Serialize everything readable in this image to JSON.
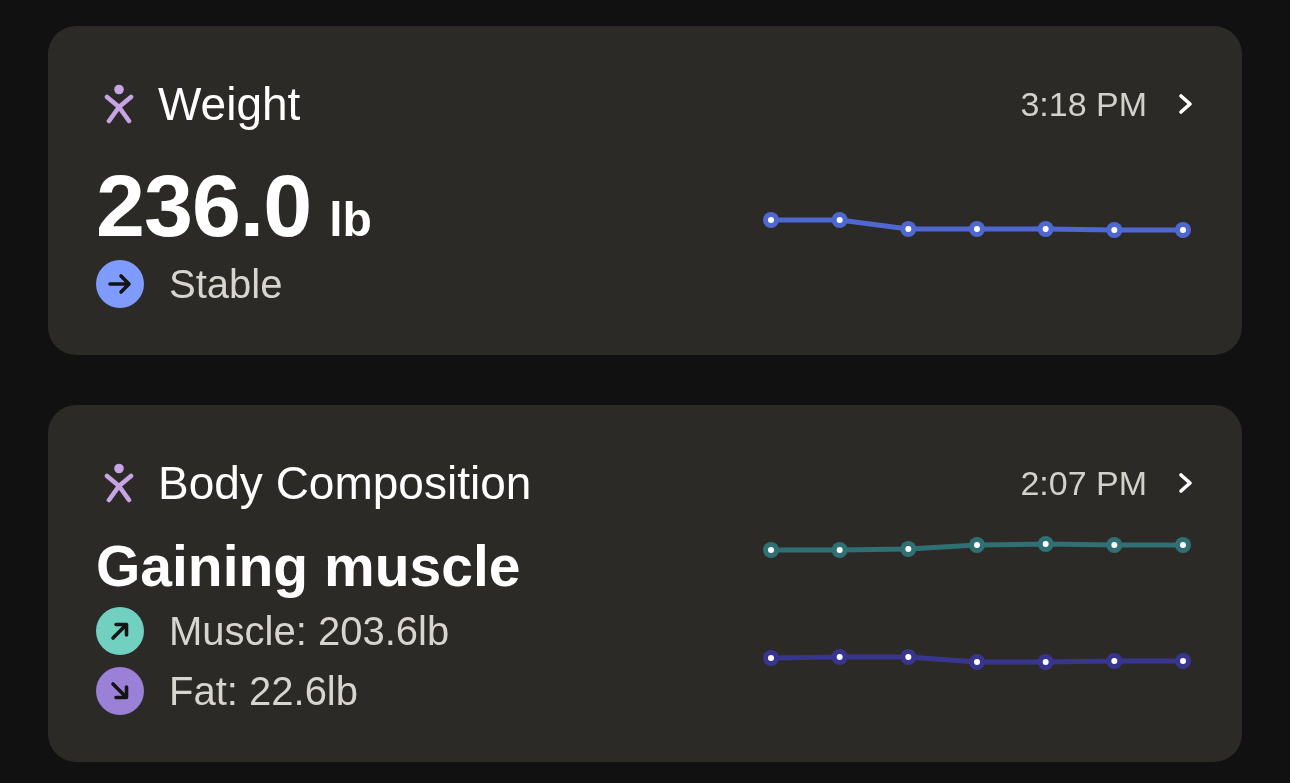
{
  "cards": [
    {
      "kind": "weight",
      "title": "Weight",
      "time": "3:18 PM",
      "value": "236.0",
      "unit": "lb",
      "trends": [
        {
          "kind": "flat",
          "color": "#7e9bfd",
          "label": "Stable"
        }
      ],
      "sparklines": [
        {
          "color": "#4f67d0"
        }
      ]
    },
    {
      "kind": "composition",
      "title": "Body Composition",
      "time": "2:07 PM",
      "headline": "Gaining muscle",
      "trends": [
        {
          "kind": "up",
          "color": "#72d0c0",
          "label": "Muscle: 203.6lb"
        },
        {
          "kind": "down",
          "color": "#9b80d8",
          "label": "Fat: 22.6lb"
        }
      ],
      "sparklines": [
        {
          "color": "#2f7074"
        },
        {
          "color": "#38358e"
        }
      ]
    }
  ]
}
